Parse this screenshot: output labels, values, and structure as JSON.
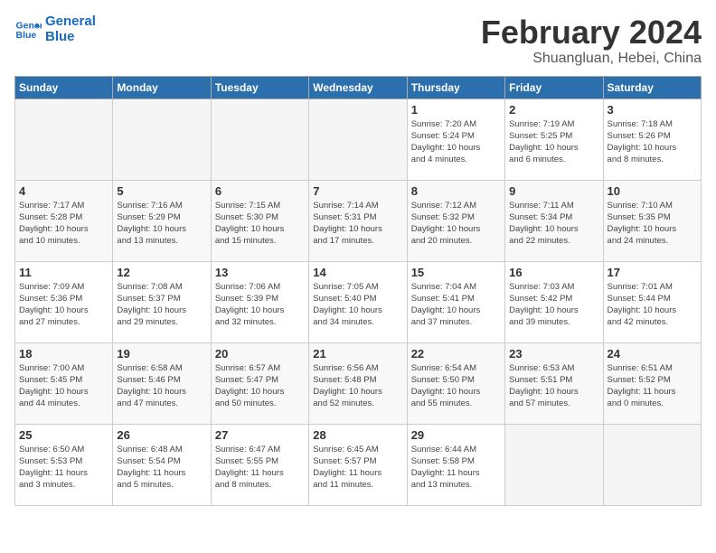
{
  "logo": {
    "line1": "General",
    "line2": "Blue"
  },
  "title": "February 2024",
  "subtitle": "Shuangluan, Hebei, China",
  "days_of_week": [
    "Sunday",
    "Monday",
    "Tuesday",
    "Wednesday",
    "Thursday",
    "Friday",
    "Saturday"
  ],
  "weeks": [
    [
      {
        "day": "",
        "info": ""
      },
      {
        "day": "",
        "info": ""
      },
      {
        "day": "",
        "info": ""
      },
      {
        "day": "",
        "info": ""
      },
      {
        "day": "1",
        "info": "Sunrise: 7:20 AM\nSunset: 5:24 PM\nDaylight: 10 hours\nand 4 minutes."
      },
      {
        "day": "2",
        "info": "Sunrise: 7:19 AM\nSunset: 5:25 PM\nDaylight: 10 hours\nand 6 minutes."
      },
      {
        "day": "3",
        "info": "Sunrise: 7:18 AM\nSunset: 5:26 PM\nDaylight: 10 hours\nand 8 minutes."
      }
    ],
    [
      {
        "day": "4",
        "info": "Sunrise: 7:17 AM\nSunset: 5:28 PM\nDaylight: 10 hours\nand 10 minutes."
      },
      {
        "day": "5",
        "info": "Sunrise: 7:16 AM\nSunset: 5:29 PM\nDaylight: 10 hours\nand 13 minutes."
      },
      {
        "day": "6",
        "info": "Sunrise: 7:15 AM\nSunset: 5:30 PM\nDaylight: 10 hours\nand 15 minutes."
      },
      {
        "day": "7",
        "info": "Sunrise: 7:14 AM\nSunset: 5:31 PM\nDaylight: 10 hours\nand 17 minutes."
      },
      {
        "day": "8",
        "info": "Sunrise: 7:12 AM\nSunset: 5:32 PM\nDaylight: 10 hours\nand 20 minutes."
      },
      {
        "day": "9",
        "info": "Sunrise: 7:11 AM\nSunset: 5:34 PM\nDaylight: 10 hours\nand 22 minutes."
      },
      {
        "day": "10",
        "info": "Sunrise: 7:10 AM\nSunset: 5:35 PM\nDaylight: 10 hours\nand 24 minutes."
      }
    ],
    [
      {
        "day": "11",
        "info": "Sunrise: 7:09 AM\nSunset: 5:36 PM\nDaylight: 10 hours\nand 27 minutes."
      },
      {
        "day": "12",
        "info": "Sunrise: 7:08 AM\nSunset: 5:37 PM\nDaylight: 10 hours\nand 29 minutes."
      },
      {
        "day": "13",
        "info": "Sunrise: 7:06 AM\nSunset: 5:39 PM\nDaylight: 10 hours\nand 32 minutes."
      },
      {
        "day": "14",
        "info": "Sunrise: 7:05 AM\nSunset: 5:40 PM\nDaylight: 10 hours\nand 34 minutes."
      },
      {
        "day": "15",
        "info": "Sunrise: 7:04 AM\nSunset: 5:41 PM\nDaylight: 10 hours\nand 37 minutes."
      },
      {
        "day": "16",
        "info": "Sunrise: 7:03 AM\nSunset: 5:42 PM\nDaylight: 10 hours\nand 39 minutes."
      },
      {
        "day": "17",
        "info": "Sunrise: 7:01 AM\nSunset: 5:44 PM\nDaylight: 10 hours\nand 42 minutes."
      }
    ],
    [
      {
        "day": "18",
        "info": "Sunrise: 7:00 AM\nSunset: 5:45 PM\nDaylight: 10 hours\nand 44 minutes."
      },
      {
        "day": "19",
        "info": "Sunrise: 6:58 AM\nSunset: 5:46 PM\nDaylight: 10 hours\nand 47 minutes."
      },
      {
        "day": "20",
        "info": "Sunrise: 6:57 AM\nSunset: 5:47 PM\nDaylight: 10 hours\nand 50 minutes."
      },
      {
        "day": "21",
        "info": "Sunrise: 6:56 AM\nSunset: 5:48 PM\nDaylight: 10 hours\nand 52 minutes."
      },
      {
        "day": "22",
        "info": "Sunrise: 6:54 AM\nSunset: 5:50 PM\nDaylight: 10 hours\nand 55 minutes."
      },
      {
        "day": "23",
        "info": "Sunrise: 6:53 AM\nSunset: 5:51 PM\nDaylight: 10 hours\nand 57 minutes."
      },
      {
        "day": "24",
        "info": "Sunrise: 6:51 AM\nSunset: 5:52 PM\nDaylight: 11 hours\nand 0 minutes."
      }
    ],
    [
      {
        "day": "25",
        "info": "Sunrise: 6:50 AM\nSunset: 5:53 PM\nDaylight: 11 hours\nand 3 minutes."
      },
      {
        "day": "26",
        "info": "Sunrise: 6:48 AM\nSunset: 5:54 PM\nDaylight: 11 hours\nand 5 minutes."
      },
      {
        "day": "27",
        "info": "Sunrise: 6:47 AM\nSunset: 5:55 PM\nDaylight: 11 hours\nand 8 minutes."
      },
      {
        "day": "28",
        "info": "Sunrise: 6:45 AM\nSunset: 5:57 PM\nDaylight: 11 hours\nand 11 minutes."
      },
      {
        "day": "29",
        "info": "Sunrise: 6:44 AM\nSunset: 5:58 PM\nDaylight: 11 hours\nand 13 minutes."
      },
      {
        "day": "",
        "info": ""
      },
      {
        "day": "",
        "info": ""
      }
    ]
  ]
}
